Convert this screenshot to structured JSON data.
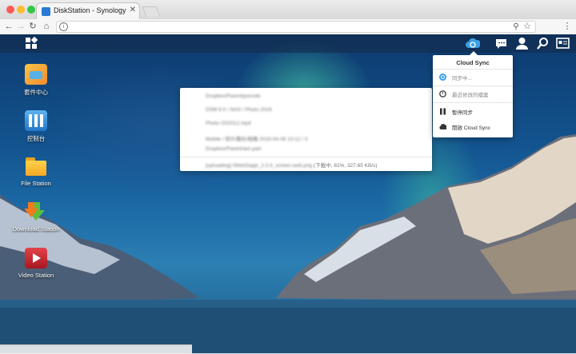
{
  "browser": {
    "tab_title": "DiskStation - Synology DiskSt",
    "close_glyph": "✕",
    "colors": {
      "close": "#fc5b57",
      "minimize": "#fdbc2e",
      "maximize": "#33c748"
    }
  },
  "taskbar": {
    "icons": [
      "main-menu-icon",
      "cloud-sync-icon",
      "notifications-icon",
      "user-icon",
      "search-icon",
      "widgets-icon"
    ]
  },
  "desktop_icons": [
    {
      "label": "套件中心",
      "icon": "package-center-icon"
    },
    {
      "label": "控制台",
      "icon": "control-panel-icon"
    },
    {
      "label": "File Station",
      "icon": "file-station-icon"
    },
    {
      "label": "Download Station",
      "icon": "download-station-icon"
    },
    {
      "label": "Video Station",
      "icon": "video-station-icon"
    }
  ],
  "notification_panel": {
    "lines": [
      "Dropbox/Parent/pocode",
      "DSM 6.0 / NAS / Photo 2016",
      "Photo /202012.mp4",
      "Mobile / 照片備份/相機 2016-04-06 10:12 / 3",
      "Dropbox/Parent/am.part"
    ],
    "footer_file": "[uploading] /WebStage_2.3.4_screen.web.png",
    "footer_status": "(下載中, 81%, 327.65 KB/s)"
  },
  "cloud_sync_menu": {
    "title": "Cloud Sync",
    "items": [
      {
        "label": "同步中...",
        "icon": "sync-icon",
        "dim": true
      },
      {
        "label": "最近修改的檔案",
        "icon": "clock-icon",
        "dim": true
      },
      {
        "label": "暫停同步",
        "icon": "pause-icon",
        "dim": false
      },
      {
        "label": "開啟 Cloud Sync",
        "icon": "cloud-icon",
        "dim": false
      }
    ]
  }
}
